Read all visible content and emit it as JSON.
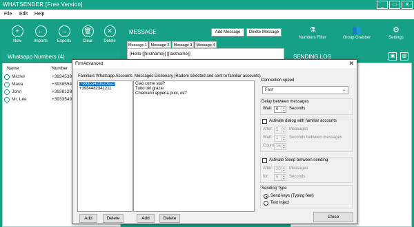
{
  "app": {
    "title": "WHATSENDER [Free Version]"
  },
  "window_controls": {
    "minimize": "_",
    "maximize": "□",
    "close": "✕"
  },
  "menu": [
    "File",
    "Edit",
    "Help"
  ],
  "toolbar": [
    {
      "label": "New",
      "icon": "plus-icon",
      "glyph": "+"
    },
    {
      "label": "Imports",
      "icon": "import-icon",
      "glyph": "←"
    },
    {
      "label": "Exports",
      "icon": "export-icon",
      "glyph": "→"
    },
    {
      "label": "Clear",
      "icon": "trash-icon",
      "glyph": "🗑"
    },
    {
      "label": "Delete",
      "icon": "delete-icon",
      "glyph": "✕"
    }
  ],
  "numbers_panel": {
    "title": "Whatsapp Numbers (4)",
    "col_name": "Name",
    "col_number": "Number",
    "rows": [
      {
        "name": "Michel",
        "number": "+39345388"
      },
      {
        "name": "Maria",
        "number": "+39385543"
      },
      {
        "name": "John",
        "number": "+39381284"
      },
      {
        "name": "Mr. Lee",
        "number": "+39335495"
      }
    ]
  },
  "message_panel": {
    "title": "MESSAGE",
    "add_label": "Add Message",
    "delete_label": "Delete Message",
    "tabs": [
      "Message 1",
      "Message 2",
      "Message 3",
      "Message 4"
    ],
    "body": "[Hello [[firstname]] [[lastname]]"
  },
  "right_panel": {
    "numbers_filter": "Numbers Filter",
    "group_grabber": "Group Grabber",
    "settings": "Settings",
    "log_title": "SENDING LOG",
    "save_icon": "save-icon",
    "trash_icon": "trash-icon"
  },
  "dialog": {
    "title": "FrmAdvanced",
    "close": "✕",
    "familiar_label": "Familiars Whatsapp Accounts",
    "familiar_items": [
      "+39355423123123",
      "+3934482341211"
    ],
    "dict_label": "Messages Dictionary (Radom selected and sent to familiar accounts)",
    "dict_items": [
      "Ciao come stai?",
      "Tutto ok! grazie",
      "Chiamami appena puoi, ok?"
    ],
    "add": "Add",
    "delete": "Delete",
    "connection_speed_label": "Connection speed",
    "connection_speed_value": "Fast",
    "delay_label": "Delay between messages",
    "wait_label": "Wait:",
    "wait_value": "0",
    "seconds": "Seconds",
    "familiar_dialog_label": "Activate dialog with familiar accounts",
    "after_label": "After:",
    "after_value": "5",
    "messages": "Messages",
    "wait_value2": "1",
    "seconds_between": "Seconds between messages",
    "count_label": "Count:",
    "count_value": "15",
    "sleep_label": "Activate Sleep between sending",
    "after_value2": "20",
    "for_label": "for:",
    "for_value": "5",
    "sending_type_label": "Sending Type",
    "send_keys": "Send keys (Typing feel)",
    "text_inject": "Text Inject",
    "close_label": "Close"
  }
}
